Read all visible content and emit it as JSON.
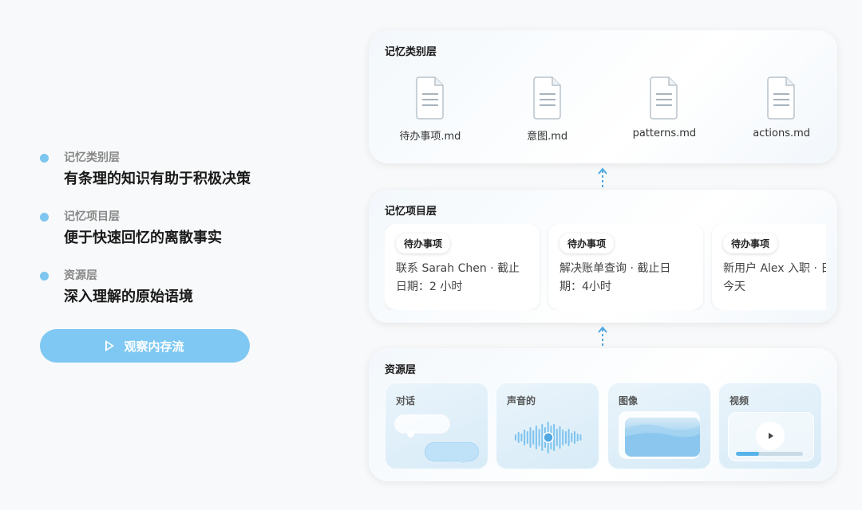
{
  "legend": [
    {
      "label": "记忆类别层",
      "desc": "有条理的知识有助于积极决策"
    },
    {
      "label": "记忆项目层",
      "desc": "便于快速回忆的离散事实"
    },
    {
      "label": "资源层",
      "desc": "深入理解的原始语境"
    }
  ],
  "observe_button": {
    "label": "观察内存流"
  },
  "categories_layer": {
    "title": "记忆类别层",
    "files": [
      "待办事项.md",
      "意图.md",
      "patterns.md",
      "actions.md"
    ]
  },
  "items_layer": {
    "title": "记忆项目层",
    "cards": [
      {
        "tag": "待办事项",
        "text": "联系 Sarah Chen · 截止日期：2 小时"
      },
      {
        "tag": "待办事项",
        "text": "解决账单查询 · 截止日期：4小时"
      },
      {
        "tag": "待办事项",
        "text": "新用户 Alex 入职 · 日期：今天"
      }
    ]
  },
  "resources_layer": {
    "title": "资源层",
    "cards": [
      {
        "label": "对话",
        "icon": "chat-bubbles-icon"
      },
      {
        "label": "声音的",
        "icon": "audio-wave-icon"
      },
      {
        "label": "图像",
        "icon": "image-icon"
      },
      {
        "label": "视频",
        "icon": "video-player-icon",
        "progress": 0.35
      }
    ]
  },
  "colors": {
    "accent": "#7ec8f3",
    "dot": "#7cc6f0",
    "wave": "#7ec3ee"
  }
}
